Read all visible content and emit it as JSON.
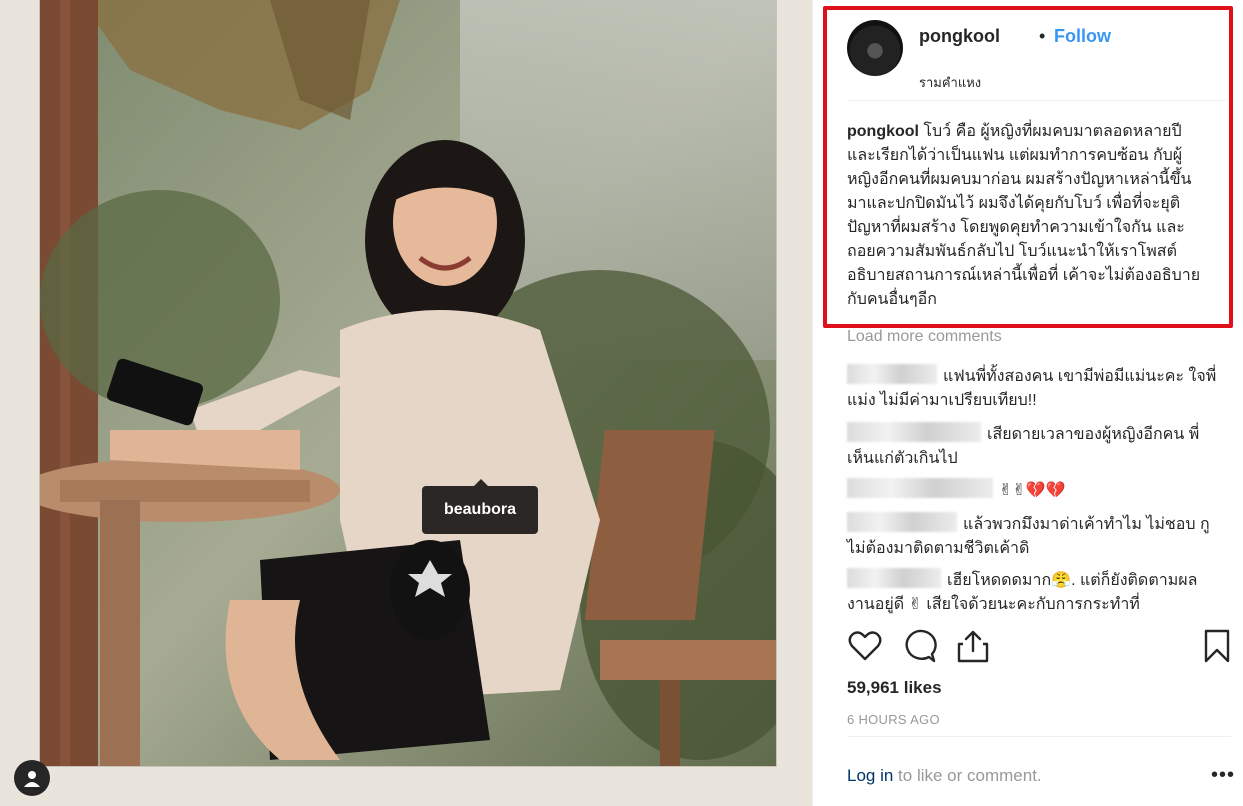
{
  "photo": {
    "tag_label": "beaubora"
  },
  "post": {
    "username": "pongkool",
    "separator": "•",
    "follow_label": "Follow",
    "location": "รามคำแหง",
    "caption_user": "pongkool",
    "caption_text": " โบว์ คือ ผู้หญิงที่ผมคบมาตลอดหลายปี และเรียกได้ว่าเป็นแฟน แต่ผมทำการคบซ้อน กับผู้หญิงอีกคนที่ผมคบมาก่อน ผมสร้างปัญหาเหล่านี้ขึ้นมาและปกปิดมันไว้ ผมจึงได้คุยกับโบว์ เพื่อที่จะยุติปัญหาที่ผมสร้าง โดยพูดคุยทำความเข้าใจกัน และถอยความสัมพันธ์กลับไป โบว์แนะนำให้เราโพสต์อธิบายสถานการณ์เหล่านี้เพื่อที่ เค้าจะไม่ต้องอธิบายกับคนอื่นๆอีก"
  },
  "comments": {
    "load_more": "Load more comments",
    "items": [
      {
        "text": "แฟนพี่ทั้งสองคน เขามีพ่อมีแม่นะคะ ใจพี่แม่ง ไม่มีค่ามาเปรียบเทียบ!!"
      },
      {
        "text": "เสียดายเวลาของผู้หญิงอีกคน พี่เห็นแก่ตัวเกินไป"
      },
      {
        "text": "✌✌",
        "emoji": "💔💔"
      },
      {
        "text": "แล้วพวกมึงมาด่าเค้าทำไม ไม่ชอบ กูไม่ต้องมาติดตามชีวิตเค้าดิ"
      },
      {
        "text": "เฮียโหดดดมาก😤. แต่ก็ยังติดตามผลงานอยู่ดี ✌ เสียใจด้วยนะคะกับการกระทำที่"
      }
    ]
  },
  "actions": {
    "like_icon": "heart-icon",
    "comment_icon": "comment-icon",
    "share_icon": "share-icon",
    "save_icon": "bookmark-icon"
  },
  "stats": {
    "likes": "59,961 likes",
    "timestamp": "6 HOURS AGO"
  },
  "footer": {
    "login_link": "Log in",
    "login_rest": " to like or comment.",
    "more_label": "•••"
  },
  "colors": {
    "accent": "#3897f0",
    "highlight": "#e0101a",
    "muted": "#999999"
  }
}
